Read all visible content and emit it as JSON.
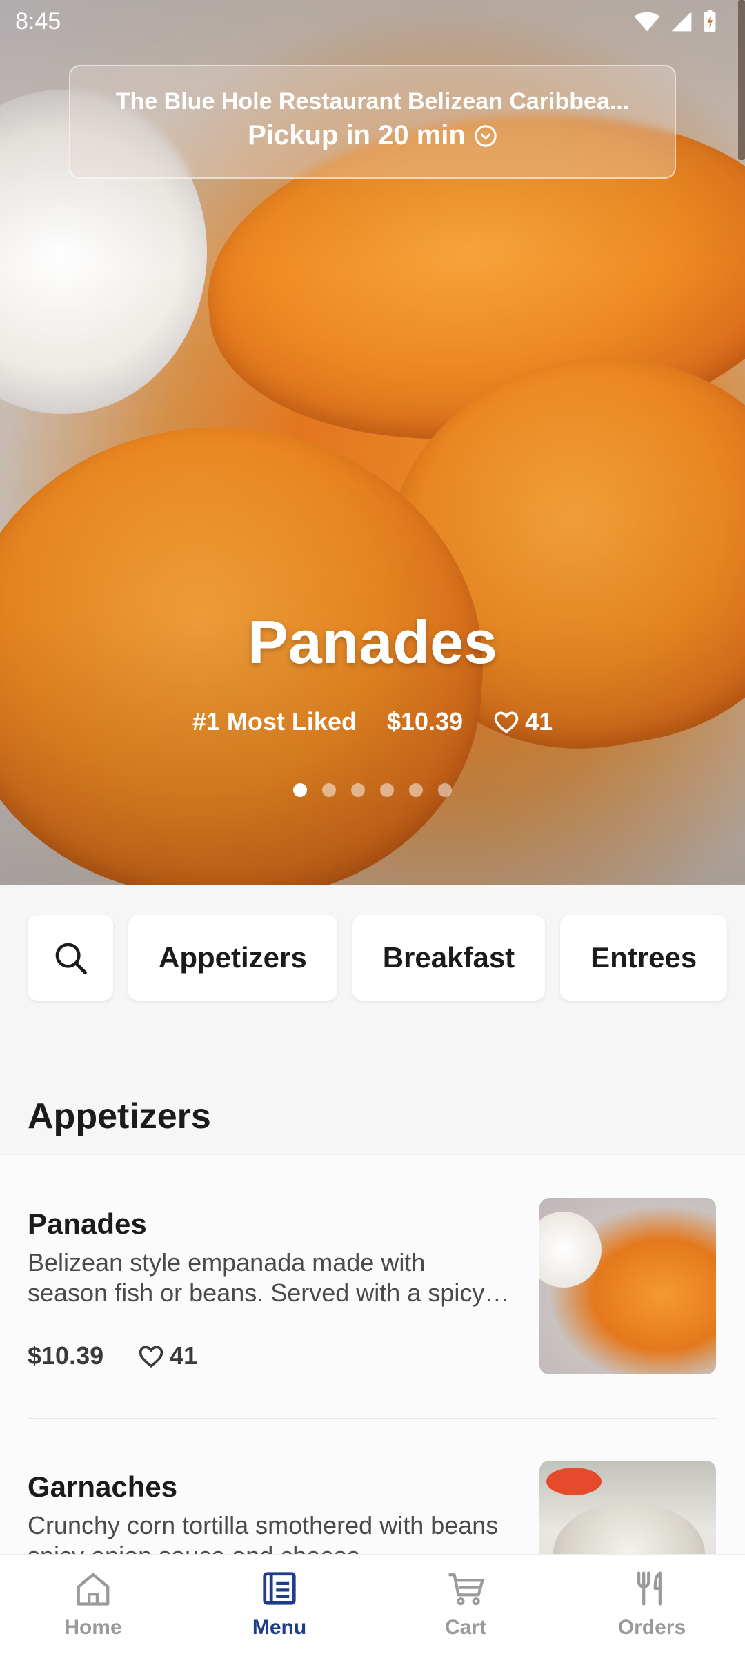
{
  "status_bar": {
    "time": "8:45"
  },
  "header": {
    "restaurant": "The Blue Hole Restaurant Belizean Caribbea...",
    "pickup": "Pickup in 20 min"
  },
  "hero": {
    "title": "Panades",
    "badge": "#1 Most Liked",
    "price": "$10.39",
    "likes": "41",
    "carousel_count": 6,
    "carousel_active": 1
  },
  "categories": {
    "items": [
      "Appetizers",
      "Breakfast",
      "Entrees"
    ]
  },
  "section": {
    "title": "Appetizers"
  },
  "menu_items": [
    {
      "name": "Panades",
      "description": "Belizean style empanada made with season fish or beans. Served with a spicy onion sauce.",
      "price": "$10.39",
      "likes": "41"
    },
    {
      "name": "Garnaches",
      "description": "Crunchy corn tortilla smothered with beans spicy onion sauce and cheese."
    }
  ],
  "bottom_nav": {
    "items": [
      {
        "label": "Home",
        "icon": "home-icon"
      },
      {
        "label": "Menu",
        "icon": "menu-icon"
      },
      {
        "label": "Cart",
        "icon": "cart-icon"
      },
      {
        "label": "Orders",
        "icon": "utensils-icon"
      }
    ],
    "active": "Menu"
  },
  "colors": {
    "accent": "#1f3d8a",
    "inactive": "#9a9a9a"
  }
}
